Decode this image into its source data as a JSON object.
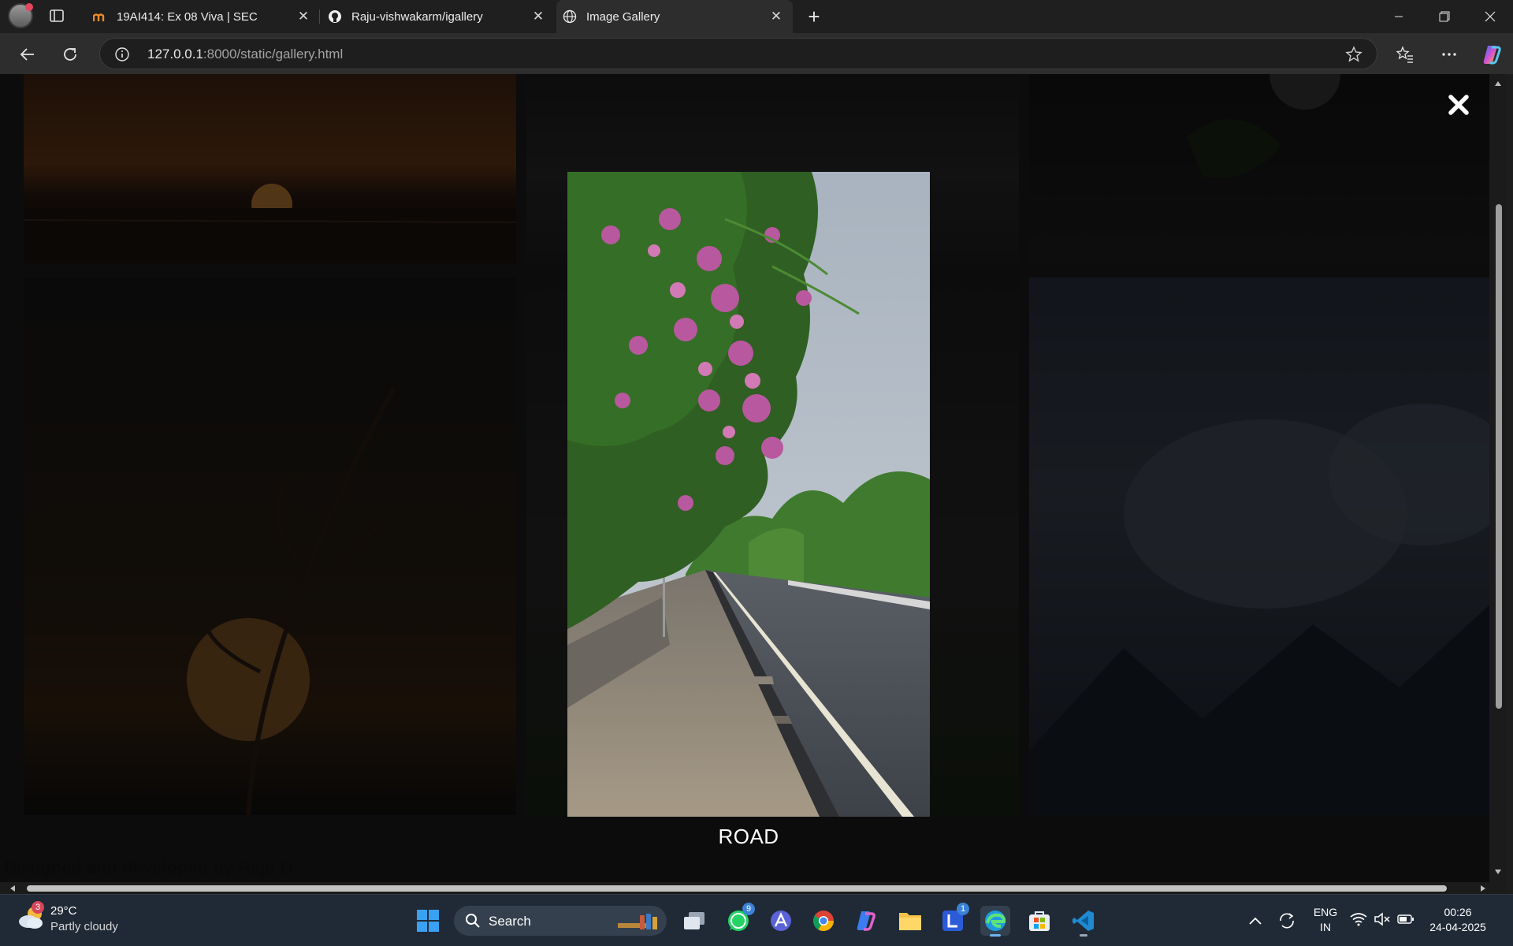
{
  "browser": {
    "tabs": [
      {
        "title": "19AI414: Ex 08 Viva | SEC",
        "favicon": "moodle-icon",
        "active": false
      },
      {
        "title": "Raju-vishwakarm/igallery",
        "favicon": "github-icon",
        "active": false
      },
      {
        "title": "Image Gallery",
        "favicon": "globe-icon",
        "active": true
      }
    ],
    "address": {
      "host": "127.0.0.1",
      "path": ":8000/static/gallery.html"
    }
  },
  "gallery": {
    "lightbox": {
      "caption": "ROAD",
      "close_symbol": "✖"
    },
    "footer": "Designed and developed by Raju D",
    "scroll": {
      "vertical_position": 0.42
    }
  },
  "taskbar": {
    "weather": {
      "temp": "29°C",
      "condition": "Partly cloudy",
      "badge": "3"
    },
    "search_label": "Search",
    "whatsapp_badge": "9",
    "teams_badge": "1",
    "tray": {
      "lang_top": "ENG",
      "lang_bottom": "IN",
      "time": "00:26",
      "date": "24-04-2025"
    }
  },
  "colors": {
    "accent": "#3b82d6",
    "page_bg": "#1d1d1d",
    "taskbar_bg": "#202a36"
  }
}
